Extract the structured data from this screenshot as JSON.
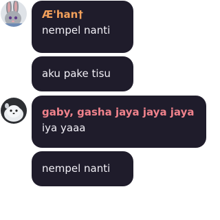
{
  "messages": [
    {
      "sender": "Æ'han†",
      "sender_color": "#f4a15b",
      "text": "nempel nanti",
      "avatar": "bunny-avatar-icon"
    },
    {
      "text": "aku pake tisu"
    },
    {
      "sender": "gaby, gasha jaya jaya jaya",
      "sender_color": "#f0828c",
      "text": "iya yaaa",
      "avatar": "seal-avatar-icon"
    },
    {
      "text": "nempel nanti"
    }
  ],
  "colors": {
    "bubble_bg": "#1f1c2b",
    "message_text": "#f3f1f7",
    "page_bg": "#ffffff"
  }
}
